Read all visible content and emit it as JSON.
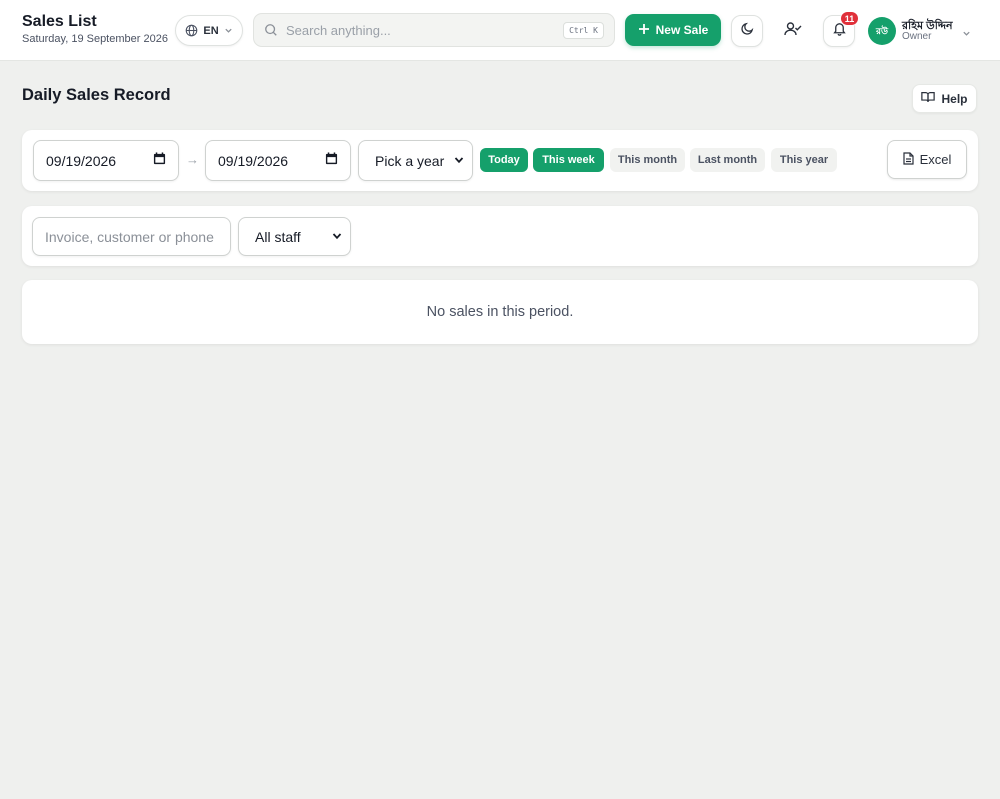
{
  "header": {
    "title": "Sales List",
    "date": "Saturday, 19 September 2026",
    "language": "EN",
    "search_placeholder": "Search anything...",
    "search_shortcut": "Ctrl K",
    "new_sale_label": "New Sale",
    "notification_count": "11",
    "user": {
      "initials": "রউ",
      "name": "রহিম উদ্দিন",
      "role": "Owner"
    }
  },
  "page": {
    "title": "Daily Sales Record",
    "help_label": "Help"
  },
  "filters": {
    "date_from": "09/19/2026",
    "date_to": "09/19/2026",
    "arrow": "→",
    "year_select": "Pick a year",
    "quick_ranges": [
      {
        "label": "Today",
        "active": true
      },
      {
        "label": "This week",
        "active": true
      },
      {
        "label": "This month",
        "active": false
      },
      {
        "label": "Last month",
        "active": false
      },
      {
        "label": "This year",
        "active": false
      }
    ],
    "export_label": "Excel"
  },
  "search": {
    "placeholder": "Invoice, customer or phone",
    "staff_select": "All staff"
  },
  "results": {
    "empty_message": "No sales in this period."
  },
  "colors": {
    "accent": "#15a06b",
    "badge": "#e0303a",
    "background": "#eff0ee"
  }
}
